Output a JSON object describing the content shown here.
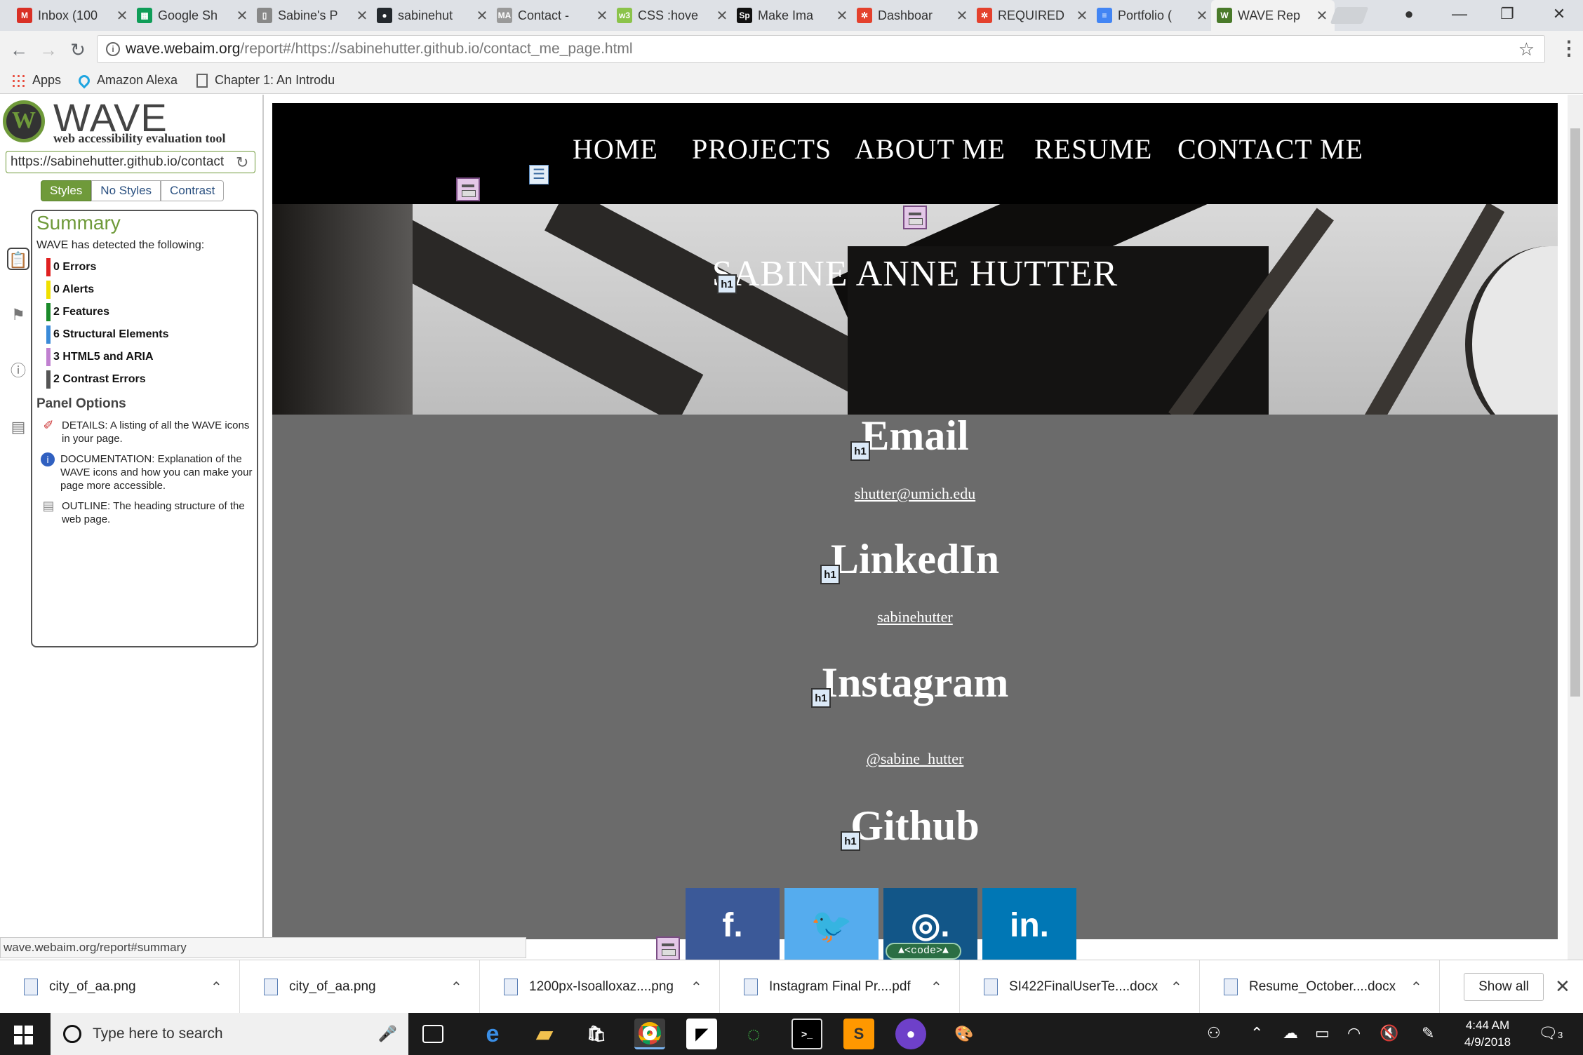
{
  "browser": {
    "tabs": [
      {
        "title": "Inbox (100",
        "favicon": "gmail-icon",
        "color": "#d93025",
        "glyph": "M"
      },
      {
        "title": "Google Sh",
        "favicon": "sheets-icon",
        "color": "#0f9d58",
        "glyph": "▦"
      },
      {
        "title": "Sabine's P",
        "favicon": "document-icon",
        "color": "#888888",
        "glyph": "▯"
      },
      {
        "title": "sabinehut",
        "favicon": "github-icon",
        "color": "#24292e",
        "glyph": "●"
      },
      {
        "title": "Contact -",
        "favicon": "ma-icon",
        "color": "#999999",
        "glyph": "MA"
      },
      {
        "title": "CSS :hove",
        "favicon": "codepen-icon",
        "color": "#8bc34a",
        "glyph": "w3"
      },
      {
        "title": "Make Ima",
        "favicon": "sp-icon",
        "color": "#111111",
        "glyph": "Sp"
      },
      {
        "title": "Dashboar",
        "favicon": "canvas-icon",
        "color": "#e4412d",
        "glyph": "✲"
      },
      {
        "title": "REQUIRED",
        "favicon": "canvas-icon",
        "color": "#e4412d",
        "glyph": "✲"
      },
      {
        "title": "Portfolio (",
        "favicon": "docs-icon",
        "color": "#4285f4",
        "glyph": "≡"
      },
      {
        "title": "WAVE Rep",
        "favicon": "wave-icon",
        "color": "#4a7a2a",
        "glyph": "W",
        "active": true
      }
    ],
    "address": {
      "host": "wave.webaim.org",
      "path": "/report#/https://sabinehutter.github.io/contact_me_page.html"
    },
    "bookmarks": [
      "Apps",
      "Amazon Alexa",
      "Chapter 1: An Introdu"
    ]
  },
  "wave": {
    "title": "WAVE",
    "subtitle": "web accessibility evaluation tool",
    "url_value": "https://sabinehutter.github.io/contact",
    "modes": [
      "Styles",
      "No Styles",
      "Contrast"
    ],
    "summary_title": "Summary",
    "detected_text": "WAVE has detected the following:",
    "summary": [
      {
        "label": "0 Errors",
        "color": "#e02020"
      },
      {
        "label": "0 Alerts",
        "color": "#f0e000"
      },
      {
        "label": "2 Features",
        "color": "#1a8a2a"
      },
      {
        "label": "6 Structural Elements",
        "color": "#3a8ad8"
      },
      {
        "label": "3 HTML5 and ARIA",
        "color": "#c080d0"
      },
      {
        "label": "2 Contrast Errors",
        "color": "#555555"
      }
    ],
    "panel_options_title": "Panel Options",
    "options": [
      {
        "icon": "flag-icon",
        "text": "DETAILS: A listing of all the WAVE icons in your page."
      },
      {
        "icon": "info-icon",
        "text": "DOCUMENTATION: Explanation of the WAVE icons and how you can make your page more accessible."
      },
      {
        "icon": "outline-icon",
        "text": "OUTLINE: The heading structure of the web page."
      }
    ]
  },
  "site": {
    "nav": [
      "HOME",
      "PROJECTS",
      "ABOUT ME",
      "RESUME",
      "CONTACT ME"
    ],
    "hero_title": "SABINE ANNE HUTTER",
    "sections": [
      {
        "heading": "Email",
        "link": "shutter@umich.edu"
      },
      {
        "heading": "LinkedIn",
        "link": "sabinehutter"
      },
      {
        "heading": "Instagram",
        "link": "@sabine_hutter"
      },
      {
        "heading": "Github",
        "link": ""
      }
    ],
    "badge_h1": "h1",
    "code_tag": "▲<code>▲",
    "social": [
      {
        "name": "facebook",
        "glyph": "f.",
        "color": "#3b5998"
      },
      {
        "name": "twitter",
        "glyph": "🐦",
        "color": "#55acee"
      },
      {
        "name": "instagram",
        "glyph": "◎.",
        "color": "#125688"
      },
      {
        "name": "linkedin",
        "glyph": "in.",
        "color": "#0077b5"
      }
    ]
  },
  "status_url": "wave.webaim.org/report#summary",
  "downloads": {
    "items": [
      "city_of_aa.png",
      "city_of_aa.png",
      "1200px-Isoalloxaz....png",
      "Instagram Final Pr....pdf",
      "SI422FinalUserTe....docx",
      "Resume_October....docx"
    ],
    "show_all": "Show all"
  },
  "taskbar": {
    "search_placeholder": "Type here to search",
    "time": "4:44 AM",
    "date": "4/9/2018",
    "notifications": "3"
  }
}
